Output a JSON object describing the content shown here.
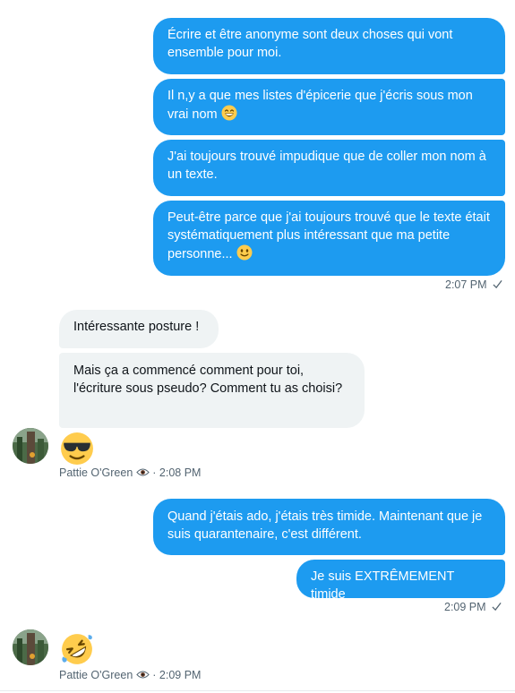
{
  "messages_out_1": [
    {
      "text": "Écrire et être anonyme sont deux choses qui vont ensemble pour moi."
    },
    {
      "text": "Il n,y a que mes listes d'épicerie que j'écris sous mon vrai nom",
      "emoji": "grinning-face-emoji"
    },
    {
      "text": "J'ai toujours trouvé impudique que de coller mon nom à un texte."
    },
    {
      "text": "Peut-être parce que j'ai toujours trouvé que le texte était systématiquement plus intéressant que ma petite personne...",
      "emoji": "slightly-smiling-face-emoji"
    }
  ],
  "time_out_1": "2:07 PM",
  "messages_in_1": [
    {
      "text": "Intéressante posture !"
    },
    {
      "text": "Mais ça a commencé comment pour toi, l'écriture sous pseudo? Comment tu as choisi?"
    }
  ],
  "emoji_in_1": "sunglasses-face-emoji",
  "sender_in_1": {
    "name": "Pattie O'Green",
    "separator": "·",
    "time": "2:08 PM"
  },
  "messages_out_2": [
    {
      "text": "Quand j'étais ado, j'étais très timide. Maintenant que je suis quarantenaire, c'est différent."
    },
    {
      "text": "Je suis EXTRÊMEMENT timide"
    }
  ],
  "time_out_2": "2:09 PM",
  "emoji_in_2": "rolling-on-floor-laughing-emoji",
  "sender_in_2": {
    "name": "Pattie O'Green",
    "separator": "·",
    "time": "2:09 PM"
  },
  "colors": {
    "outgoing": "#1d9bf0",
    "incoming": "#eff3f4",
    "meta": "#536471"
  }
}
